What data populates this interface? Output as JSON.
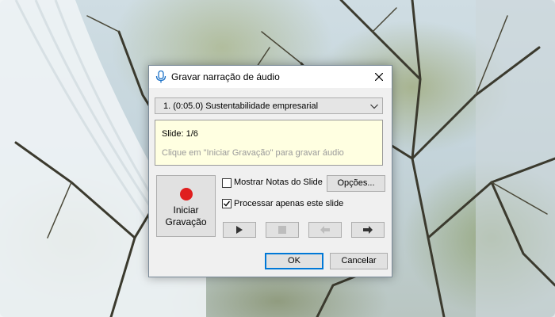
{
  "dialog": {
    "title": "Gravar narração de áudio",
    "title_icon": "microphone-icon",
    "close_icon": "close-icon"
  },
  "slide_select": {
    "selected": "1. (0:05.0) Sustentabilidade empresarial",
    "arrow_icon": "chevron-down-icon"
  },
  "info": {
    "slide": "Slide: 1/6",
    "hint": "Clique em \"Iniciar Gravação\" para gravar áudio"
  },
  "record": {
    "label_line1": "Iniciar",
    "label_line2": "Gravação",
    "color": "#e01f1f"
  },
  "options": {
    "show_notes": {
      "label": "Mostrar Notas do Slide",
      "checked": false
    },
    "process_only_this": {
      "label": "Processar apenas este slide",
      "checked": true
    },
    "options_button": "Opções..."
  },
  "media": {
    "play_icon": "play-icon",
    "stop_icon": "stop-icon",
    "previous_icon": "arrow-left-icon",
    "next_icon": "arrow-right-icon"
  },
  "footer": {
    "ok": "OK",
    "cancel": "Cancelar",
    "accent": "#0078d7"
  }
}
